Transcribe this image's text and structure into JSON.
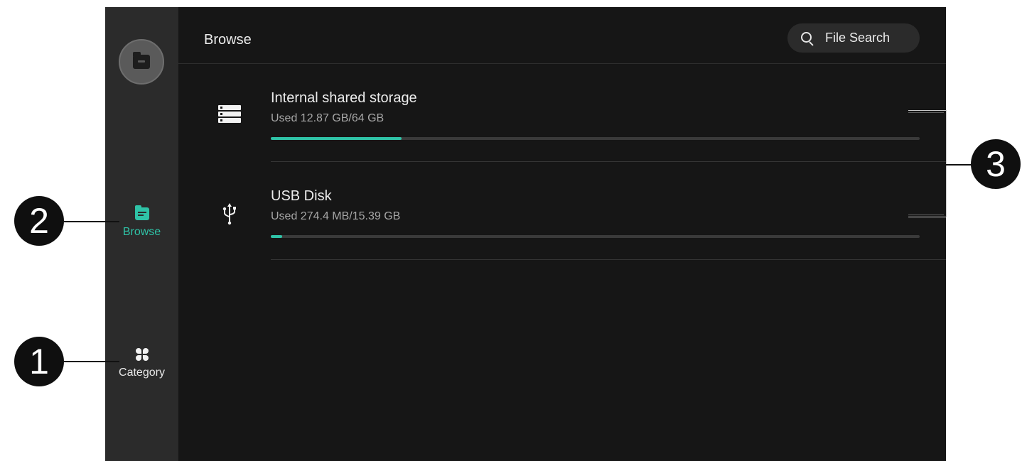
{
  "sidebar": {
    "logo_icon": "folder-icon",
    "items": [
      {
        "label": "Browse",
        "icon": "folder-document-icon",
        "active": true,
        "color": "#2fc3a7"
      },
      {
        "label": "Category",
        "icon": "category-grid-icon",
        "active": false
      }
    ]
  },
  "header": {
    "title": "Browse",
    "search_label": "File Search",
    "search_icon": "search-icon"
  },
  "storage": [
    {
      "name": "Internal shared storage",
      "usage": "Used 12.87 GB/64 GB",
      "fraction_used": 0.201,
      "icon": "server-icon"
    },
    {
      "name": "USB Disk",
      "usage": "Used 274.4 MB/15.39 GB",
      "fraction_used": 0.017,
      "icon": "usb-icon"
    }
  ],
  "callouts": [
    "1",
    "2",
    "3"
  ],
  "colors": {
    "accent": "#2fc3a7",
    "background": "#161616",
    "sidebar": "#2b2b2b"
  }
}
